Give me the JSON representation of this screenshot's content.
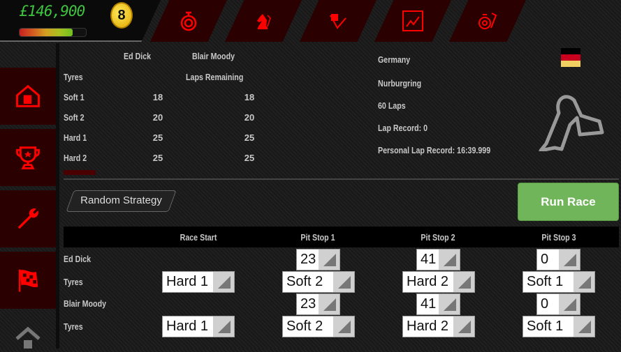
{
  "header": {
    "money": "£146,900",
    "coins": "8",
    "progress_percent": 80,
    "tabs": [
      {
        "icon": "stopwatch-icon"
      },
      {
        "icon": "chess-knight-icon"
      },
      {
        "icon": "checkered-flag-icon"
      },
      {
        "icon": "chart-icon"
      },
      {
        "icon": "stopwatch-track-icon"
      }
    ]
  },
  "sidebar": {
    "items": [
      {
        "icon": "home-icon"
      },
      {
        "icon": "trophy-icon"
      },
      {
        "icon": "wrench-icon"
      },
      {
        "icon": "race-flag-icon"
      },
      {
        "icon": "house-outline-icon"
      }
    ]
  },
  "tyres": {
    "drivers": [
      "Ed Dick",
      "Blair Moody"
    ],
    "col_tyres": "Tyres",
    "col_laps": "Laps Remaining",
    "rows": [
      {
        "name": "Soft 1",
        "ed": "18",
        "blair": "18"
      },
      {
        "name": "Soft 2",
        "ed": "20",
        "blair": "20"
      },
      {
        "name": "Hard 1",
        "ed": "25",
        "blair": "25"
      },
      {
        "name": "Hard 2",
        "ed": "25",
        "blair": "25"
      }
    ]
  },
  "track": {
    "country": "Germany",
    "name": "Nurburgring",
    "laps": "60 Laps",
    "lap_record": "Lap Record: 0",
    "personal_record": "Personal Lap Record: 16:39.999",
    "flag_colors": [
      "#000000",
      "#c8001e",
      "#f0d060"
    ]
  },
  "buttons": {
    "random": "Random Strategy",
    "run": "Run Race",
    "run_color": "#71b55a"
  },
  "strategy": {
    "headers": [
      "Race Start",
      "Pit Stop 1",
      "Pit Stop 2",
      "Pit Stop 3"
    ],
    "drivers": [
      {
        "name": "Ed Dick",
        "tyres_label": "Tyres",
        "laps": [
          "23",
          "41",
          "0"
        ],
        "tyres": [
          "Hard 1",
          "Soft 2",
          "Hard 2",
          "Soft 1"
        ]
      },
      {
        "name": "Blair Moody",
        "tyres_label": "Tyres",
        "laps": [
          "23",
          "41",
          "0"
        ],
        "tyres": [
          "Hard 1",
          "Soft 2",
          "Hard 2",
          "Soft 1"
        ]
      }
    ]
  }
}
